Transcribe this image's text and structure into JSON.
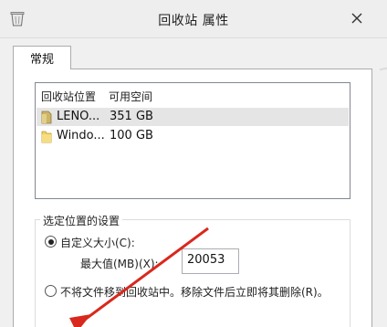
{
  "window": {
    "title": "回收站 属性",
    "icon": "recycle-bin-icon",
    "close_icon": "close-icon"
  },
  "tabs": [
    {
      "label": "常规",
      "selected": true
    }
  ],
  "recycle_list": {
    "columns": [
      "回收站位置",
      "可用空间"
    ],
    "rows": [
      {
        "name": "LENO...",
        "space": "351 GB",
        "icon": "folder-icon",
        "selected": true
      },
      {
        "name": "Windo...",
        "space": "100 GB",
        "icon": "folder-icon",
        "selected": false
      }
    ]
  },
  "settings": {
    "group_label": "选定位置的设置",
    "custom_size_label": "自定义大小(C):",
    "max_value_label": "最大值(MB)(X):",
    "max_value": "20053",
    "no_move_label": "不将文件移到回收站中。移除文件后立即将其删除(R)。",
    "custom_size_selected": true
  },
  "annotation": {
    "color": "#d9281d"
  }
}
